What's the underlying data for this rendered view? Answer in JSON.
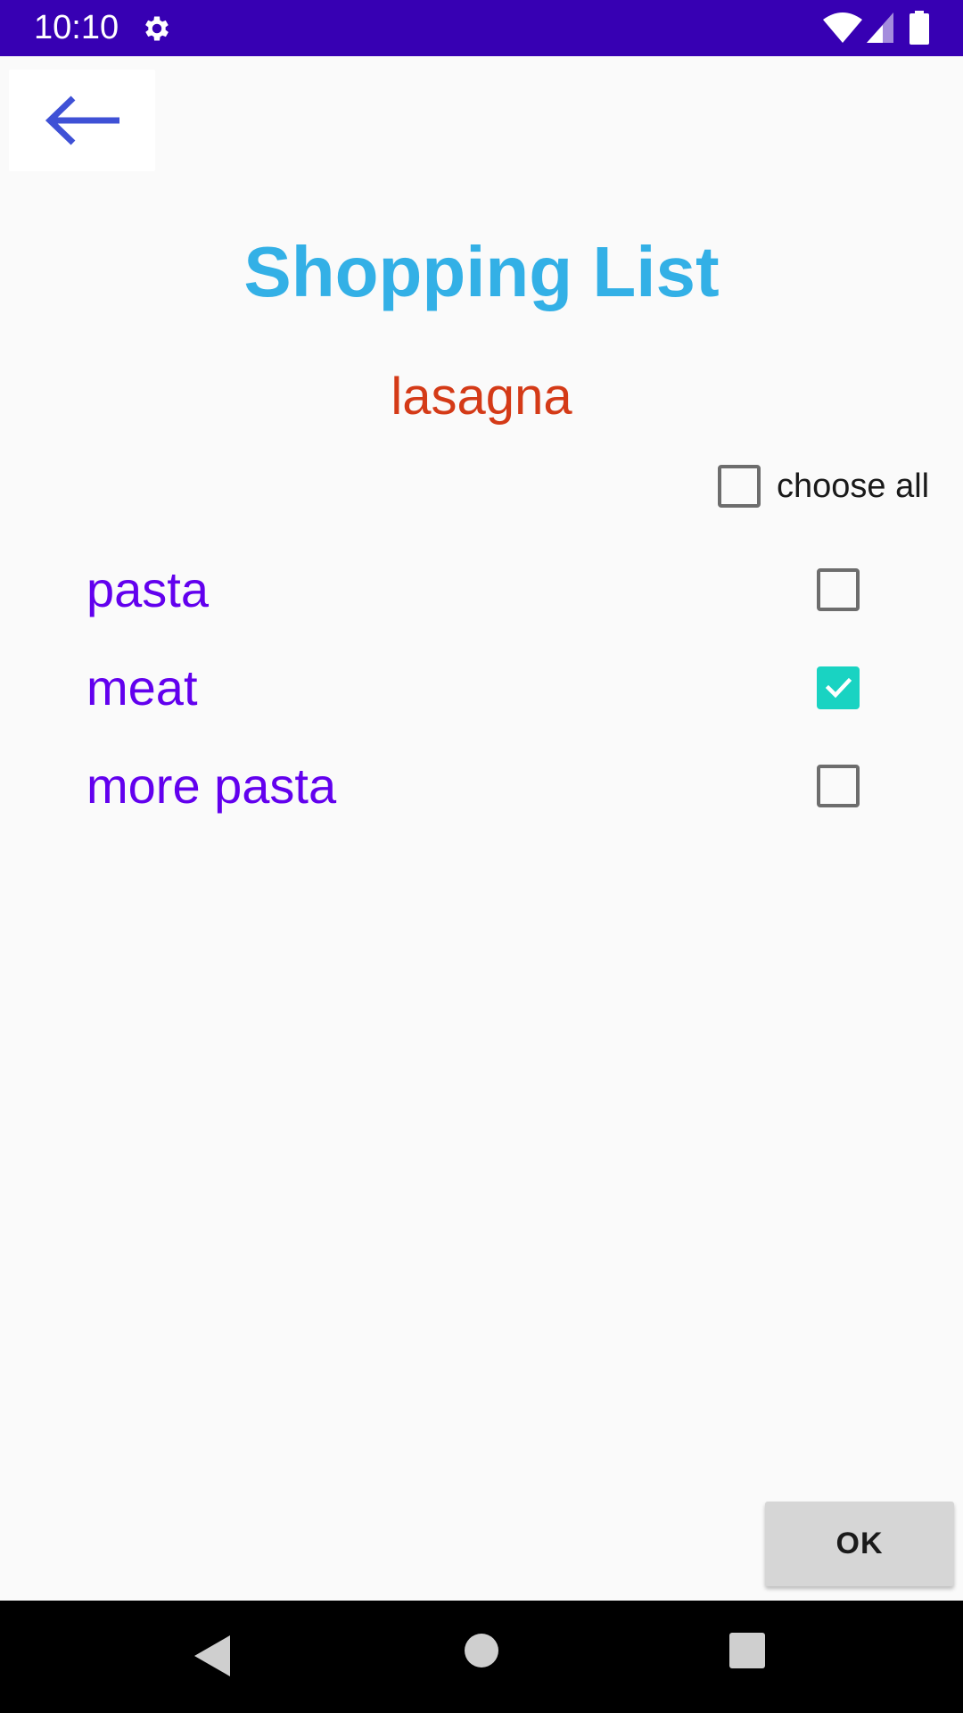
{
  "status_bar": {
    "time": "10:10",
    "icons": [
      "gear-icon",
      "wifi-icon",
      "signal-icon",
      "battery-icon"
    ],
    "background": "#3700b3"
  },
  "app": {
    "back_icon": "arrow-left-icon",
    "title": "Shopping List",
    "subtitle": "lasagna",
    "choose_all": {
      "label": "choose all",
      "checked": false
    },
    "items": [
      {
        "label": "pasta",
        "checked": false
      },
      {
        "label": "meat",
        "checked": true
      },
      {
        "label": "more pasta",
        "checked": false
      }
    ],
    "ok_label": "OK"
  },
  "colors": {
    "title": "#33b0e6",
    "subtitle": "#d43a17",
    "item_text": "#6200ee",
    "checkbox_checked": "#19d3c2",
    "back_arrow": "#3f51d6"
  },
  "nav_bar": {
    "icons": [
      "back-triangle-icon",
      "home-circle-icon",
      "recents-square-icon"
    ]
  }
}
